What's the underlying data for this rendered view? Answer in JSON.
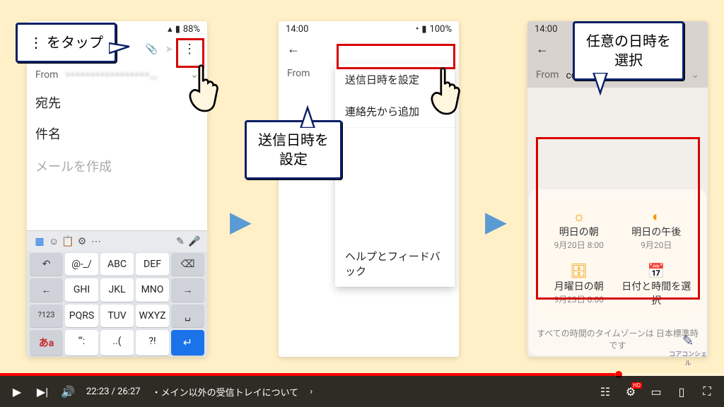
{
  "callouts": {
    "c1": "⋮ をタップ",
    "c2": "送信日時を\n設定",
    "c3": "任意の日時を\n選択"
  },
  "phone1": {
    "battery": "88%",
    "from_label": "From",
    "from_value": "･････････････････...",
    "to_label": "宛先",
    "subject_label": "件名",
    "compose_placeholder": "メールを作成",
    "keys_row1": [
      "@-_/",
      "ABC",
      "DEF",
      "⌫"
    ],
    "keys_row2": [
      "←",
      "GHI",
      "JKL",
      "MNO",
      "→"
    ],
    "keys_row3": [
      "?123",
      "PQRS",
      "TUV",
      "WXYZ",
      "␣"
    ],
    "keys_row4": [
      "あa",
      "'\":",
      "..(",
      "?!",
      "↵"
    ]
  },
  "phone2": {
    "time": "14:00",
    "battery": "100%",
    "from_label": "From",
    "menu_schedule": "送信日時を設定",
    "menu_add_contact": "連絡先から追加",
    "menu_help": "ヘルプとフィードバック"
  },
  "phone3": {
    "time": "14:00",
    "from_label": "From",
    "from_value": "cor･･････er20･･･",
    "sched": {
      "tomMorn": {
        "title": "明日の朝",
        "sub": "9月20日 8:00"
      },
      "tomAft": {
        "title": "明日の午後",
        "sub": "9月20日"
      },
      "monMorn": {
        "title": "月曜日の朝",
        "sub": "9月23日 8:00"
      },
      "pick": {
        "title": "日付と時間を選択",
        "sub": ""
      }
    },
    "tz_note": "すべての時間のタイムゾーンは 日本標準時 です"
  },
  "logo_label": "コアコンシェル",
  "video": {
    "time": "22:23 / 26:27",
    "chapter": "・メイン以外の受信トレイについて"
  }
}
